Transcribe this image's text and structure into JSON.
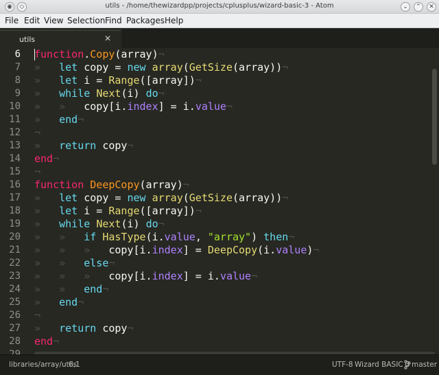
{
  "window": {
    "title": "utils - /home/thewizardpp/projects/cplusplus/wizard-basic-3 - Atom",
    "minimize_glyph": "⌄",
    "maximize_glyph": "⌃",
    "close_glyph": "✕"
  },
  "menu": [
    "File",
    "Edit",
    "View",
    "Selection",
    "Find",
    "Packages",
    "Help"
  ],
  "tabs": [
    {
      "label": "utils",
      "close_glyph": "✕",
      "active": true
    }
  ],
  "editor": {
    "lines": [
      {
        "n": "6",
        "tokens": [
          [
            "kw",
            "function"
          ],
          [
            "",
            "."
          ],
          [
            "fn",
            "Copy"
          ],
          [
            "",
            "(array)"
          ],
          [
            "inv",
            "¬"
          ]
        ]
      },
      {
        "n": "7",
        "tokens": [
          [
            "ws",
            "»   "
          ],
          [
            "kd",
            "let"
          ],
          [
            "",
            " copy = "
          ],
          [
            "kd",
            "new"
          ],
          [
            "",
            " "
          ],
          [
            "bi",
            "array"
          ],
          [
            "",
            "("
          ],
          [
            "bi",
            "GetSize"
          ],
          [
            "",
            "(array))"
          ],
          [
            "inv",
            "¬"
          ]
        ]
      },
      {
        "n": "8",
        "tokens": [
          [
            "ws",
            "»   "
          ],
          [
            "kd",
            "let"
          ],
          [
            "",
            " i = "
          ],
          [
            "bi",
            "Range"
          ],
          [
            "",
            "([array])"
          ],
          [
            "inv",
            "¬"
          ]
        ]
      },
      {
        "n": "9",
        "tokens": [
          [
            "ws",
            "»   "
          ],
          [
            "kd",
            "while"
          ],
          [
            "",
            " "
          ],
          [
            "bi",
            "Next"
          ],
          [
            "",
            "(i) "
          ],
          [
            "kd",
            "do"
          ],
          [
            "inv",
            "¬"
          ]
        ]
      },
      {
        "n": "10",
        "tokens": [
          [
            "ws",
            "»   »   "
          ],
          [
            "",
            "copy[i."
          ],
          [
            "tp",
            "index"
          ],
          [
            "",
            "] = i."
          ],
          [
            "tp",
            "value"
          ],
          [
            "inv",
            "¬"
          ]
        ]
      },
      {
        "n": "11",
        "tokens": [
          [
            "ws",
            "»   "
          ],
          [
            "kd",
            "end"
          ],
          [
            "inv",
            "¬"
          ]
        ]
      },
      {
        "n": "12",
        "tokens": [
          [
            "inv",
            "¬"
          ]
        ]
      },
      {
        "n": "13",
        "tokens": [
          [
            "ws",
            "»   "
          ],
          [
            "kd",
            "return"
          ],
          [
            "",
            " copy"
          ],
          [
            "inv",
            "¬"
          ]
        ]
      },
      {
        "n": "14",
        "tokens": [
          [
            "kw",
            "end"
          ],
          [
            "inv",
            "¬"
          ]
        ]
      },
      {
        "n": "15",
        "tokens": [
          [
            "inv",
            "¬"
          ]
        ]
      },
      {
        "n": "16",
        "tokens": [
          [
            "kw",
            "function"
          ],
          [
            "",
            " "
          ],
          [
            "fn",
            "DeepCopy"
          ],
          [
            "",
            "(array)"
          ],
          [
            "inv",
            "¬"
          ]
        ]
      },
      {
        "n": "17",
        "tokens": [
          [
            "ws",
            "»   "
          ],
          [
            "kd",
            "let"
          ],
          [
            "",
            " copy = "
          ],
          [
            "kd",
            "new"
          ],
          [
            "",
            " "
          ],
          [
            "bi",
            "array"
          ],
          [
            "",
            "("
          ],
          [
            "bi",
            "GetSize"
          ],
          [
            "",
            "(array))"
          ],
          [
            "inv",
            "¬"
          ]
        ]
      },
      {
        "n": "18",
        "tokens": [
          [
            "ws",
            "»   "
          ],
          [
            "kd",
            "let"
          ],
          [
            "",
            " i = "
          ],
          [
            "bi",
            "Range"
          ],
          [
            "",
            "([array])"
          ],
          [
            "inv",
            "¬"
          ]
        ]
      },
      {
        "n": "19",
        "tokens": [
          [
            "ws",
            "»   "
          ],
          [
            "kd",
            "while"
          ],
          [
            "",
            " "
          ],
          [
            "bi",
            "Next"
          ],
          [
            "",
            "(i) "
          ],
          [
            "kd",
            "do"
          ],
          [
            "inv",
            "¬"
          ]
        ]
      },
      {
        "n": "20",
        "tokens": [
          [
            "ws",
            "»   »   "
          ],
          [
            "kd",
            "if"
          ],
          [
            "",
            " "
          ],
          [
            "bi",
            "HasType"
          ],
          [
            "",
            "(i."
          ],
          [
            "tp",
            "value"
          ],
          [
            ",",
            ", "
          ],
          [
            "st",
            "\"array\""
          ],
          [
            "",
            ") "
          ],
          [
            "kd",
            "then"
          ],
          [
            "inv",
            "¬"
          ]
        ]
      },
      {
        "n": "21",
        "tokens": [
          [
            "ws",
            "»   »   »   "
          ],
          [
            "",
            "copy[i."
          ],
          [
            "tp",
            "index"
          ],
          [
            "",
            "] = "
          ],
          [
            "bi",
            "DeepCopy"
          ],
          [
            "",
            "(i."
          ],
          [
            "tp",
            "value"
          ],
          [
            "",
            ")"
          ],
          [
            "inv",
            "¬"
          ]
        ]
      },
      {
        "n": "22",
        "tokens": [
          [
            "ws",
            "»   »   "
          ],
          [
            "kd",
            "else"
          ],
          [
            "inv",
            "¬"
          ]
        ]
      },
      {
        "n": "23",
        "tokens": [
          [
            "ws",
            "»   »   »   "
          ],
          [
            "",
            "copy[i."
          ],
          [
            "tp",
            "index"
          ],
          [
            "",
            "] = i."
          ],
          [
            "tp",
            "value"
          ],
          [
            "inv",
            "¬"
          ]
        ]
      },
      {
        "n": "24",
        "tokens": [
          [
            "ws",
            "»   »   "
          ],
          [
            "kd",
            "end"
          ],
          [
            "inv",
            "¬"
          ]
        ]
      },
      {
        "n": "25",
        "tokens": [
          [
            "ws",
            "»   "
          ],
          [
            "kd",
            "end"
          ],
          [
            "inv",
            "¬"
          ]
        ]
      },
      {
        "n": "26",
        "tokens": [
          [
            "inv",
            "¬"
          ]
        ]
      },
      {
        "n": "27",
        "tokens": [
          [
            "ws",
            "»   "
          ],
          [
            "kd",
            "return"
          ],
          [
            "",
            " copy"
          ],
          [
            "inv",
            "¬"
          ]
        ]
      },
      {
        "n": "28",
        "tokens": [
          [
            "kw",
            "end"
          ],
          [
            "inv",
            "¬"
          ]
        ]
      },
      {
        "n": "29",
        "tokens": []
      }
    ],
    "active_line": "6"
  },
  "status": {
    "file_path": "libraries/array/utils",
    "cursor_position": "6,1",
    "encoding": "UTF-8",
    "grammar": "Wizard BASIC 3",
    "branch": "master",
    "branch_icon": "git-branch-icon"
  }
}
